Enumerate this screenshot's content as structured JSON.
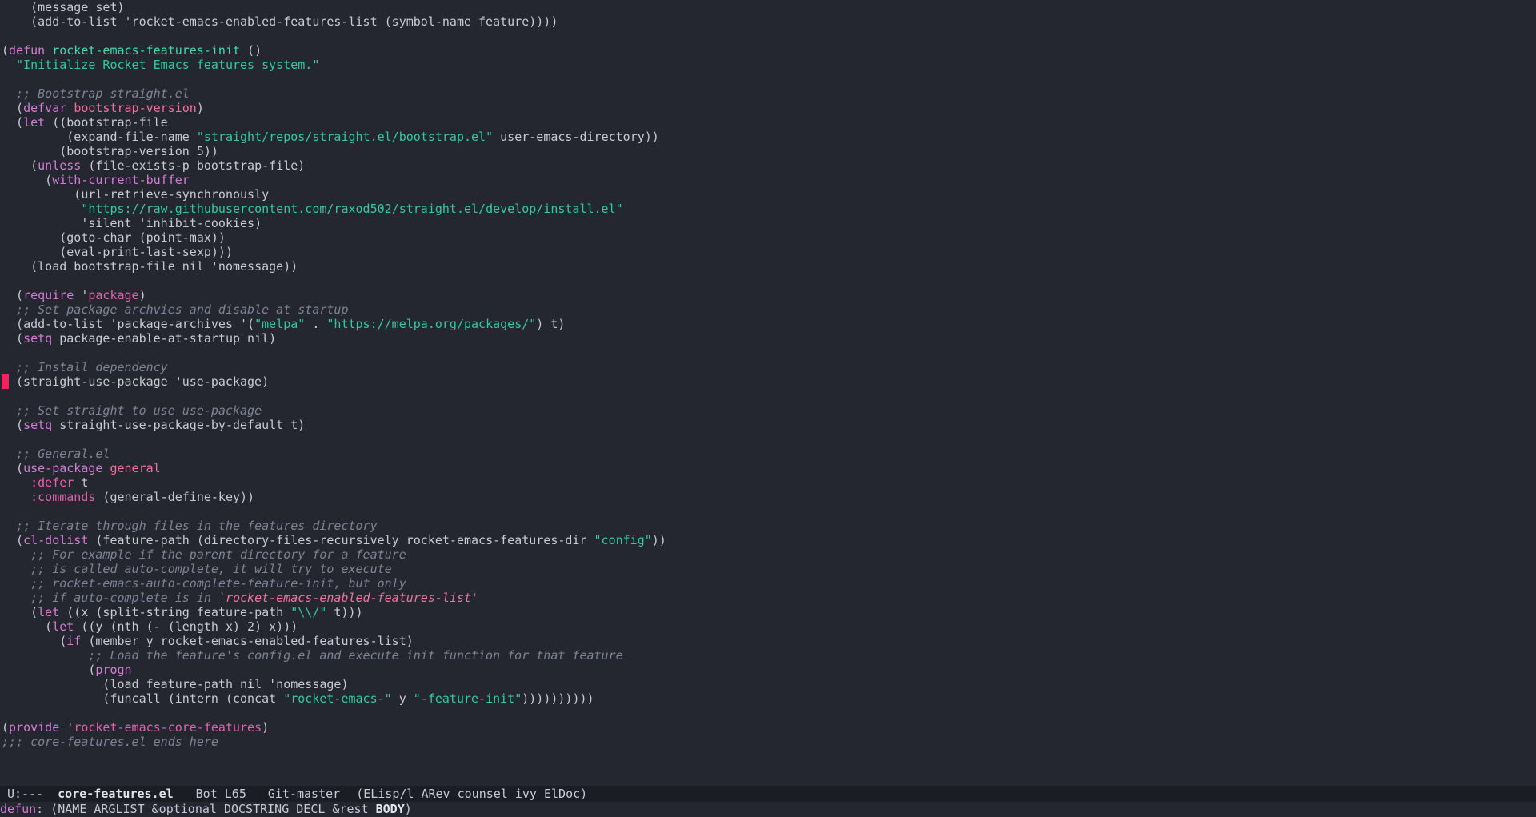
{
  "buffer": {
    "lines": [
      [
        [
          "default",
          "    (message set)"
        ]
      ],
      [
        [
          "default",
          "    (add-to-list 'rocket-emacs-enabled-features-list (symbol-name feature))))"
        ]
      ],
      [],
      [
        [
          "default",
          "("
        ],
        [
          "keyword",
          "defun"
        ],
        [
          "default",
          " "
        ],
        [
          "func",
          "rocket-emacs-features-init"
        ],
        [
          "default",
          " ()"
        ]
      ],
      [
        [
          "doc",
          "  \"Initialize Rocket Emacs features system.\""
        ]
      ],
      [],
      [
        [
          "comment",
          "  ;; Bootstrap straight.el"
        ]
      ],
      [
        [
          "default",
          "  ("
        ],
        [
          "keyword",
          "defvar"
        ],
        [
          "default",
          " "
        ],
        [
          "var",
          "bootstrap-version"
        ],
        [
          "default",
          ")"
        ]
      ],
      [
        [
          "default",
          "  ("
        ],
        [
          "keyword",
          "let"
        ],
        [
          "default",
          " ((bootstrap-file"
        ]
      ],
      [
        [
          "default",
          "         (expand-file-name "
        ],
        [
          "string",
          "\"straight/repos/straight.el/bootstrap.el\""
        ],
        [
          "default",
          " user-emacs-directory))"
        ]
      ],
      [
        [
          "default",
          "        (bootstrap-version 5))"
        ]
      ],
      [
        [
          "default",
          "    ("
        ],
        [
          "keyword",
          "unless"
        ],
        [
          "default",
          " (file-exists-p bootstrap-file)"
        ]
      ],
      [
        [
          "default",
          "      ("
        ],
        [
          "keyword",
          "with-current-buffer"
        ]
      ],
      [
        [
          "default",
          "          (url-retrieve-synchronously"
        ]
      ],
      [
        [
          "default",
          "           "
        ],
        [
          "string",
          "\"https://raw.githubusercontent.com/raxod502/straight.el/develop/install.el\""
        ]
      ],
      [
        [
          "default",
          "           'silent 'inhibit-cookies)"
        ]
      ],
      [
        [
          "default",
          "        (goto-char (point-max))"
        ]
      ],
      [
        [
          "default",
          "        (eval-print-last-sexp)))"
        ]
      ],
      [
        [
          "default",
          "    (load bootstrap-file nil 'nomessage))"
        ]
      ],
      [],
      [
        [
          "default",
          "  ("
        ],
        [
          "keyword",
          "require"
        ],
        [
          "default",
          " '"
        ],
        [
          "const",
          "package"
        ],
        [
          "default",
          ")"
        ]
      ],
      [
        [
          "comment",
          "  ;; Set package archvies and disable at startup"
        ]
      ],
      [
        [
          "default",
          "  (add-to-list 'package-archives '("
        ],
        [
          "string",
          "\"melpa\""
        ],
        [
          "default",
          " . "
        ],
        [
          "string",
          "\"https://melpa.org/packages/\""
        ],
        [
          "default",
          ") t)"
        ]
      ],
      [
        [
          "default",
          "  ("
        ],
        [
          "keyword",
          "setq"
        ],
        [
          "default",
          " package-enable-at-startup nil)"
        ]
      ],
      [],
      [
        [
          "comment",
          "  ;; Install dependency"
        ]
      ],
      [
        [
          "cursor",
          ""
        ],
        [
          "default",
          " (straight-use-package 'use-package)"
        ]
      ],
      [],
      [
        [
          "comment",
          "  ;; Set straight to use use-package"
        ]
      ],
      [
        [
          "default",
          "  ("
        ],
        [
          "keyword",
          "setq"
        ],
        [
          "default",
          " straight-use-package-by-default t)"
        ]
      ],
      [],
      [
        [
          "comment",
          "  ;; General.el"
        ]
      ],
      [
        [
          "default",
          "  ("
        ],
        [
          "keyword",
          "use-package"
        ],
        [
          "default",
          " "
        ],
        [
          "var",
          "general"
        ]
      ],
      [
        [
          "default",
          "    "
        ],
        [
          "const",
          ":defer"
        ],
        [
          "default",
          " t"
        ]
      ],
      [
        [
          "default",
          "    "
        ],
        [
          "const",
          ":commands"
        ],
        [
          "default",
          " (general-define-key))"
        ]
      ],
      [],
      [
        [
          "comment",
          "  ;; Iterate through files in the features directory"
        ]
      ],
      [
        [
          "default",
          "  ("
        ],
        [
          "keyword",
          "cl-dolist"
        ],
        [
          "default",
          " (feature-path (directory-files-recursively rocket-emacs-features-dir "
        ],
        [
          "string",
          "\"config\""
        ],
        [
          "default",
          "))"
        ]
      ],
      [
        [
          "comment",
          "    ;; For example if the parent directory for a feature"
        ]
      ],
      [
        [
          "comment",
          "    ;; is called auto-complete, it will try to execute"
        ]
      ],
      [
        [
          "comment",
          "    ;; rocket-emacs-auto-complete-feature-init, but only"
        ]
      ],
      [
        [
          "comment",
          "    ;; if auto-complete is in `"
        ],
        [
          "quoted",
          "rocket-emacs-enabled-features-list"
        ],
        [
          "comment",
          "'"
        ]
      ],
      [
        [
          "default",
          "    ("
        ],
        [
          "keyword",
          "let"
        ],
        [
          "default",
          " ((x (split-string feature-path "
        ],
        [
          "string",
          "\"\\\\/\""
        ],
        [
          "default",
          " t)))"
        ]
      ],
      [
        [
          "default",
          "      ("
        ],
        [
          "keyword",
          "let"
        ],
        [
          "default",
          " ((y (nth (- (length x) 2) x)))"
        ]
      ],
      [
        [
          "default",
          "        ("
        ],
        [
          "keyword",
          "if"
        ],
        [
          "default",
          " (member y rocket-emacs-enabled-features-list)"
        ]
      ],
      [
        [
          "comment",
          "            ;; Load the feature's config.el and execute init function for that feature"
        ]
      ],
      [
        [
          "default",
          "            ("
        ],
        [
          "keyword",
          "progn"
        ]
      ],
      [
        [
          "default",
          "              (load feature-path nil 'nomessage)"
        ]
      ],
      [
        [
          "default",
          "              (funcall (intern (concat "
        ],
        [
          "string",
          "\"rocket-emacs-\""
        ],
        [
          "default",
          " y "
        ],
        [
          "string",
          "\"-feature-init\""
        ],
        [
          "default",
          "))))))))))"
        ]
      ],
      [],
      [
        [
          "default",
          "("
        ],
        [
          "keyword",
          "provide"
        ],
        [
          "default",
          " '"
        ],
        [
          "const",
          "rocket-emacs-core-features"
        ],
        [
          "default",
          ")"
        ]
      ],
      [
        [
          "comment",
          ";;; core-features.el ends here"
        ]
      ]
    ]
  },
  "mode_line": {
    "state": "U:---",
    "buffer_name": "core-features.el",
    "position": "Bot L65",
    "vc": "Git-master",
    "modes": "(ELisp/l ARev counsel ivy ElDoc)"
  },
  "echo_area": {
    "keyword": "defun",
    "signature_start": ": (NAME ARGLIST &optional DOCSTRING DECL &rest ",
    "signature_bold": "BODY",
    "signature_end": ")"
  },
  "colors": {
    "background": "#242730",
    "mode_line_bg": "#1b1d24",
    "keyword": "#d27dd6",
    "function": "#46d9ae",
    "variable": "#f2709f",
    "string": "#32c8a3",
    "comment": "#7e8395",
    "cursor": "#f2245e"
  }
}
